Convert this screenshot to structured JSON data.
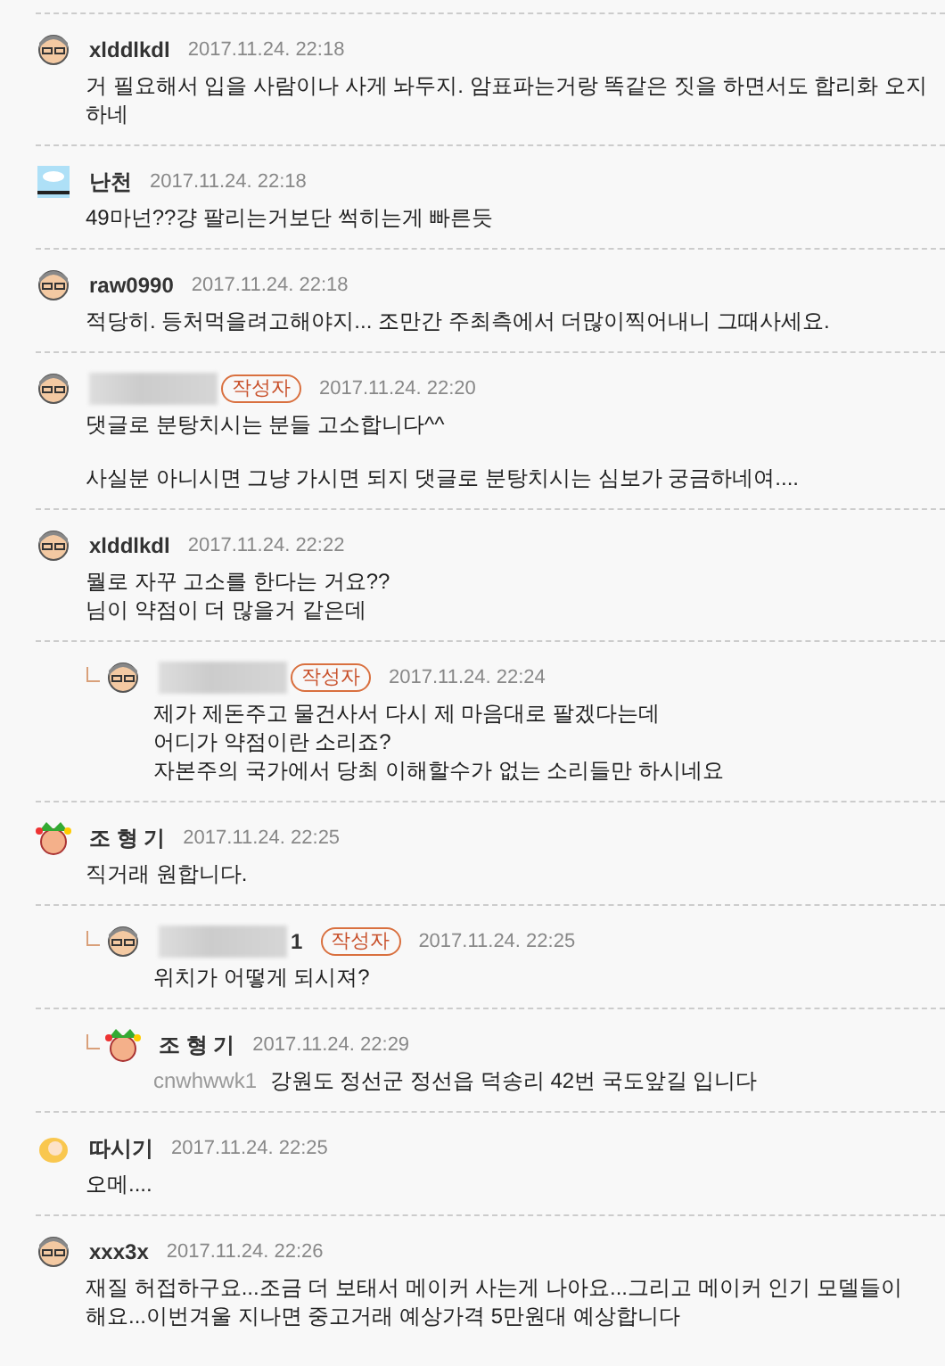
{
  "comments": [
    {
      "kind": "comment",
      "avatar": {
        "kind": "glasses"
      },
      "author": "xlddlkdl",
      "time": "2017.11.24. 22:18",
      "paragraphs": [
        [
          "거 필요해서 입을 사람이나 사게 놔두지. 암표파는거랑 똑같은 짓을 하면서도 합리화 오지",
          "하네"
        ]
      ]
    },
    {
      "kind": "comment",
      "avatar": {
        "kind": "sky"
      },
      "author": "난천",
      "time": "2017.11.24. 22:18",
      "paragraphs": [
        [
          "49마넌??걍 팔리는거보단 썩히는게 빠른듯"
        ]
      ]
    },
    {
      "kind": "comment",
      "avatar": {
        "kind": "glasses"
      },
      "author": "raw0990",
      "time": "2017.11.24. 22:18",
      "paragraphs": [
        [
          "적당히. 등처먹을려고해야지... 조만간 주최측에서 더많이찍어내니 그때사세요."
        ]
      ]
    },
    {
      "kind": "comment",
      "avatar": {
        "kind": "glasses"
      },
      "redacted": true,
      "badge": "작성자",
      "time": "2017.11.24. 22:20",
      "paragraphs": [
        [
          "댓글로 분탕치시는 분들 고소합니다^^"
        ],
        [
          "사실분 아니시면 그냥 가시면 되지 댓글로 분탕치시는 심보가 궁금하네여...."
        ]
      ]
    },
    {
      "kind": "comment",
      "avatar": {
        "kind": "glasses"
      },
      "author": "xlddlkdl",
      "time": "2017.11.24. 22:22",
      "paragraphs": [
        [
          "뭘로 자꾸 고소를 한다는 거요??",
          "님이 약점이 더 많을거 같은데"
        ]
      ]
    },
    {
      "kind": "reply",
      "avatar": {
        "kind": "glasses"
      },
      "redacted": true,
      "badge": "작성자",
      "time": "2017.11.24. 22:24",
      "paragraphs": [
        [
          "제가 제돈주고 물건사서 다시 제 마음대로 팔겠다는데",
          "어디가 약점이란 소리죠?",
          "자본주의 국가에서 당최 이해할수가 없는 소리들만 하시네요"
        ]
      ]
    },
    {
      "kind": "comment",
      "avatar": {
        "kind": "jester"
      },
      "author": "조 형 기",
      "time": "2017.11.24. 22:25",
      "paragraphs": [
        [
          "직거래 원합니다."
        ]
      ]
    },
    {
      "kind": "reply",
      "avatar": {
        "kind": "glasses"
      },
      "redacted": true,
      "author": "1",
      "badge": "작성자",
      "time": "2017.11.24. 22:25",
      "paragraphs": [
        [
          "위치가 어떻게 되시져?"
        ]
      ]
    },
    {
      "kind": "reply",
      "avatar": {
        "kind": "jester"
      },
      "author": "조 형 기",
      "time": "2017.11.24. 22:29",
      "mention": "cnwhwwk1",
      "paragraphs": [
        [
          "강원도 정선군 정선읍 덕송리 42번 국도앞길 입니다"
        ]
      ]
    },
    {
      "kind": "comment",
      "avatar": {
        "kind": "baby"
      },
      "author": "따시기",
      "time": "2017.11.24. 22:25",
      "paragraphs": [
        [
          "오메...."
        ]
      ]
    },
    {
      "kind": "comment",
      "avatar": {
        "kind": "glasses"
      },
      "author": "xxx3x",
      "time": "2017.11.24. 22:26",
      "paragraphs": [
        [
          "재질 허접하구요...조금 더 보태서 메이커 사는게 나아요...그리고 메이커 인기 모델들이",
          "해요...이번겨울 지나면 중고거래 예상가격 5만원대 예상합니다"
        ]
      ]
    }
  ]
}
